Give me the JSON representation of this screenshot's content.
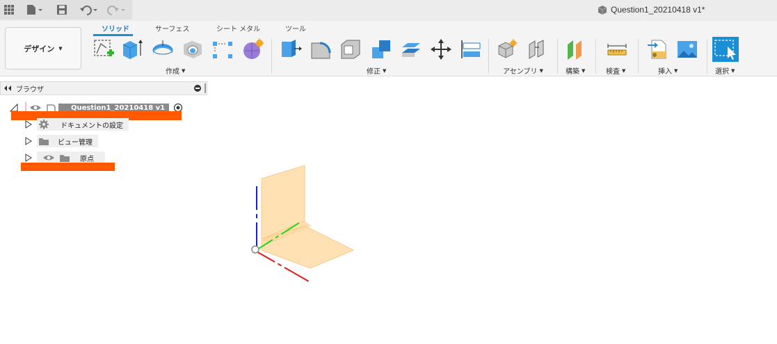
{
  "titlebar": {
    "document_title": "Question1_20210418 v1*"
  },
  "ribbon": {
    "workspace_label": "デザイン",
    "tabs": [
      "ソリッド",
      "サーフェス",
      "シート メタル",
      "ツール"
    ],
    "active_tab": "ソリッド",
    "groups": [
      "作成",
      "修正",
      "アセンブリ",
      "構築",
      "検査",
      "挿入",
      "選択"
    ]
  },
  "browser": {
    "title": "ブラウザ",
    "root": "Question1_20210418 v1",
    "items": [
      "ドキュメントの設定",
      "ビュー管理",
      "原点"
    ]
  },
  "colors": {
    "accent": "#1a8fd6",
    "redaction": "#ff5a00",
    "origin_plane": "#ffd79a",
    "x_axis": "#e21b1b",
    "y_axis": "#1a1ae0",
    "z_axis": "#22d622"
  }
}
